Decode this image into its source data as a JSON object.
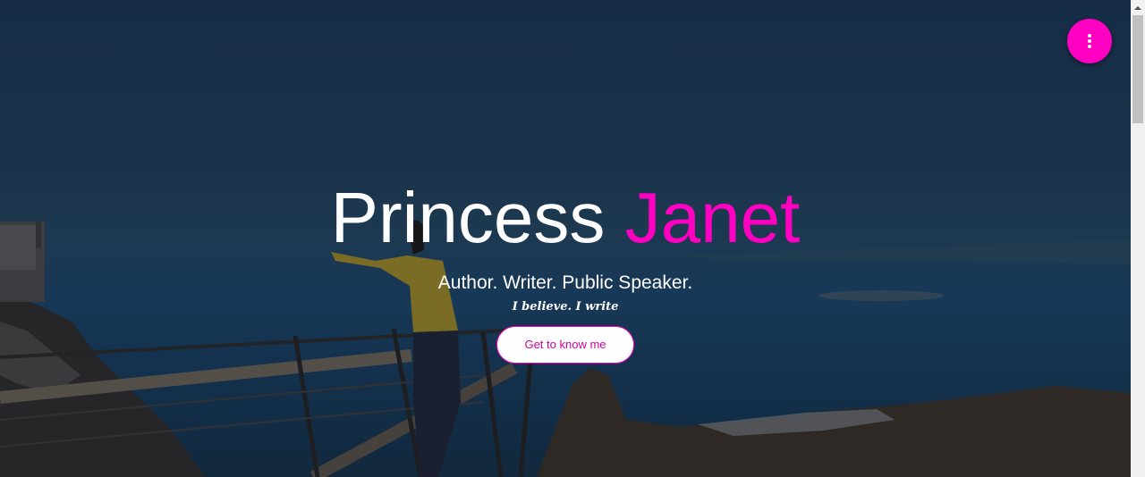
{
  "hero": {
    "title_part1": "Princess",
    "title_part2": "Janet",
    "subtitle": "Author. Writer. Public Speaker.",
    "tagline": "I believe. I write",
    "cta_label": "Get to know me"
  },
  "menu_button": {
    "icon": "more-vertical-icon"
  },
  "colors": {
    "accent": "#ff00c3",
    "text": "#ffffff",
    "cta_background": "#ffffff"
  }
}
